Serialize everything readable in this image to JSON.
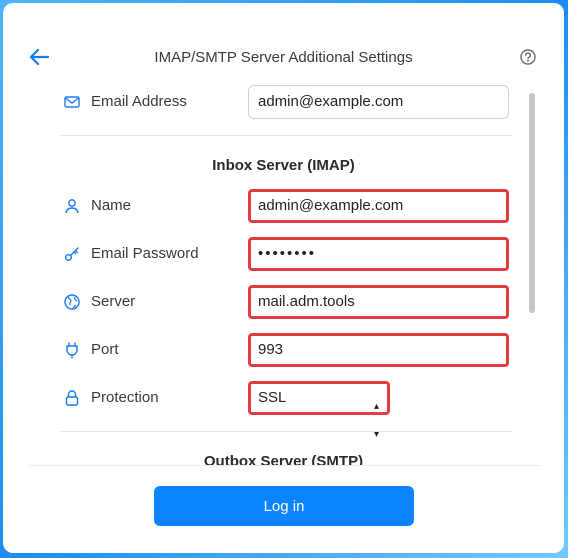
{
  "header": {
    "title": "IMAP/SMTP Server Additional Settings",
    "back_icon": "arrow-left-icon",
    "help_icon": "question-circle-icon"
  },
  "email": {
    "label": "Email Address",
    "value": "admin@example.com",
    "icon": "envelope-icon"
  },
  "inbox": {
    "section_title": "Inbox Server (IMAP)",
    "name": {
      "label": "Name",
      "value": "admin@example.com",
      "icon": "user-icon"
    },
    "password": {
      "label": "Email Password",
      "value": "••••••••",
      "icon": "key-icon"
    },
    "server": {
      "label": "Server",
      "value": "mail.adm.tools",
      "icon": "globe-icon"
    },
    "port": {
      "label": "Port",
      "value": "993",
      "icon": "plug-icon"
    },
    "protection": {
      "label": "Protection",
      "value": "SSL",
      "icon": "lock-icon"
    }
  },
  "outbox": {
    "section_title": "Outbox Server (SMTP)"
  },
  "footer": {
    "login_label": "Log in"
  },
  "colors": {
    "accent": "#0a84ff",
    "highlight": "#e23c3c",
    "background_gradient": "#1e8cf0"
  }
}
